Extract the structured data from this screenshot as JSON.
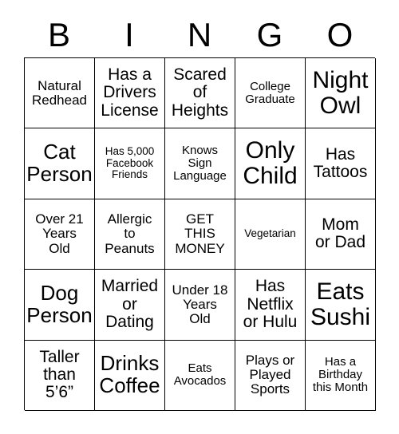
{
  "card": {
    "header_letters": [
      "B",
      "I",
      "N",
      "G",
      "O"
    ],
    "columns": 5,
    "rows": 5,
    "background_color": "#ffffff",
    "text_color": "#000000",
    "border_color": "#000000",
    "cells": [
      {
        "text": "Natural\nRedhead",
        "size": "sm"
      },
      {
        "text": "Has a\nDrivers\nLicense",
        "size": "md"
      },
      {
        "text": "Scared\nof\nHeights",
        "size": "md"
      },
      {
        "text": "College\nGraduate",
        "size": "xs"
      },
      {
        "text": "Night\nOwl",
        "size": "xl"
      },
      {
        "text": "Cat\nPerson",
        "size": "lg"
      },
      {
        "text": "Has 5,000\nFacebook\nFriends",
        "size": "xxs"
      },
      {
        "text": "Knows\nSign\nLanguage",
        "size": "xs"
      },
      {
        "text": "Only\nChild",
        "size": "xl"
      },
      {
        "text": "Has\nTattoos",
        "size": "md"
      },
      {
        "text": "Over 21\nYears\nOld",
        "size": "sm"
      },
      {
        "text": "Allergic\nto\nPeanuts",
        "size": "sm"
      },
      {
        "text": "GET\nTHIS\nMONEY",
        "size": "sm"
      },
      {
        "text": "Vegetarian",
        "size": "xxs"
      },
      {
        "text": "Mom\nor Dad",
        "size": "md"
      },
      {
        "text": "Dog\nPerson",
        "size": "lg"
      },
      {
        "text": "Married\nor\nDating",
        "size": "md"
      },
      {
        "text": "Under 18\nYears\nOld",
        "size": "sm"
      },
      {
        "text": "Has\nNetflix\nor Hulu",
        "size": "md"
      },
      {
        "text": "Eats\nSushi",
        "size": "xl"
      },
      {
        "text": "Taller\nthan\n5’6”",
        "size": "md"
      },
      {
        "text": "Drinks\nCoffee",
        "size": "lg"
      },
      {
        "text": "Eats\nAvocados",
        "size": "xs"
      },
      {
        "text": "Plays or\nPlayed\nSports",
        "size": "sm"
      },
      {
        "text": "Has a\nBirthday\nthis Month",
        "size": "xs"
      }
    ]
  }
}
